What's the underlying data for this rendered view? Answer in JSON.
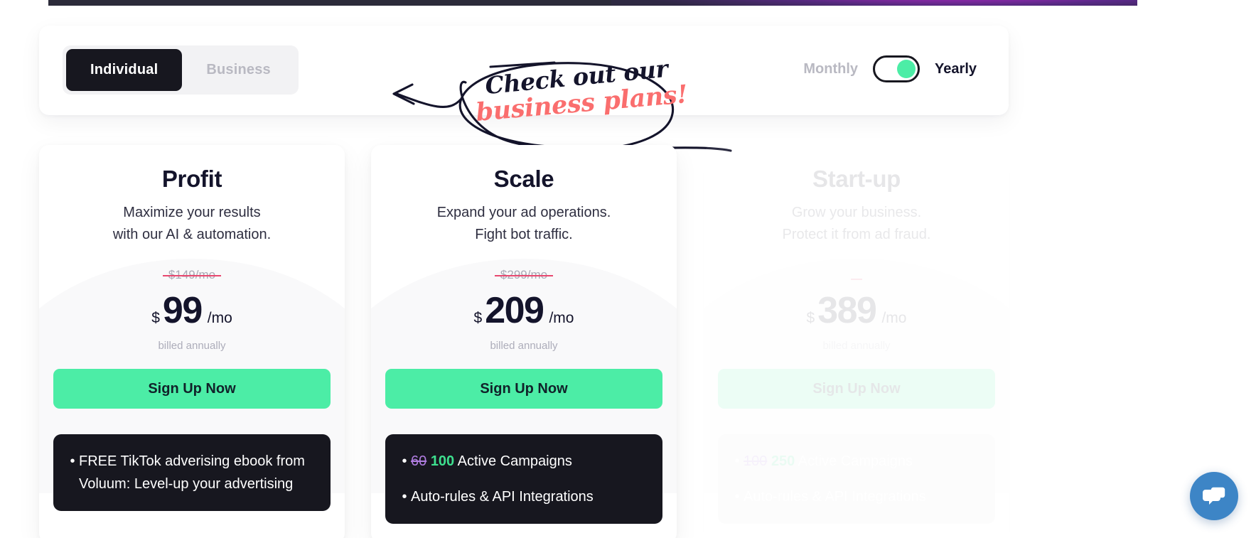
{
  "audience_toggle": {
    "options": [
      {
        "label": "Individual",
        "active": true
      },
      {
        "label": "Business",
        "active": false
      }
    ]
  },
  "annotation": {
    "line1": "Check out our",
    "line2": "business plans!",
    "line1_color": "#14142b",
    "line2_color": "#fa6e6e"
  },
  "billing_toggle": {
    "monthly_label": "Monthly",
    "yearly_label": "Yearly",
    "selected": "Yearly",
    "knob_color": "#4ceda6"
  },
  "plans": [
    {
      "name": "Profit",
      "desc_line1": "Maximize your results",
      "desc_line2": "with our AI & automation.",
      "old_price": "$149/mo",
      "currency": "$",
      "amount": "99",
      "period": "/mo",
      "billed": "billed annually",
      "cta": "Sign Up Now",
      "features": [
        {
          "old": "",
          "new": "",
          "text": "FREE TikTok adverising ebook from Voluum: Level-up your advertising"
        }
      ]
    },
    {
      "name": "Scale",
      "desc_line1": "Expand your ad operations.",
      "desc_line2": "Fight bot traffic.",
      "old_price": "$299/mo",
      "currency": "$",
      "amount": "209",
      "period": "/mo",
      "billed": "billed annually",
      "cta": "Sign Up Now",
      "features": [
        {
          "old": "60",
          "new": "100",
          "text": "Active Campaigns"
        },
        {
          "old": "",
          "new": "",
          "text": "Auto-rules & API Integrations"
        }
      ]
    },
    {
      "name": "Start-up",
      "desc_line1": "Grow your business.",
      "desc_line2": "Protect it from ad fraud.",
      "old_price": "",
      "currency": "$",
      "amount": "389",
      "period": "/mo",
      "billed": "billed annually",
      "cta": "Sign Up Now",
      "features": [
        {
          "old": "100",
          "new": "250",
          "text": "Active Campaigns"
        },
        {
          "old": "",
          "new": "",
          "text": "Auto-rules & API Integrations"
        }
      ]
    }
  ],
  "chat_widget": {
    "icon": "chat-bubbles-icon",
    "color": "#3d85c6"
  },
  "colors": {
    "accent_green": "#4ceda6",
    "dark": "#17171f",
    "strike_red": "#e8486f",
    "coral": "#fa6e6e"
  }
}
